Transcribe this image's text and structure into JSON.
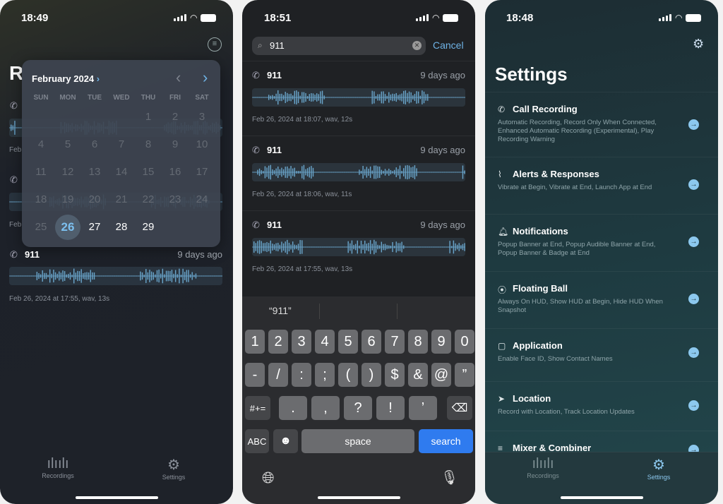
{
  "left": {
    "time": "18:49",
    "title_fragment": "R",
    "hidden_date_fragment": "Feb",
    "calendar": {
      "month": "February 2024",
      "weekdays": [
        "SUN",
        "MON",
        "TUE",
        "WED",
        "THU",
        "FRI",
        "SAT"
      ],
      "days": [
        "1",
        "2",
        "3",
        "4",
        "5",
        "6",
        "7",
        "8",
        "9",
        "10",
        "11",
        "12",
        "13",
        "14",
        "15",
        "16",
        "17",
        "18",
        "19",
        "20",
        "21",
        "22",
        "23",
        "24",
        "25",
        "26",
        "27",
        "28",
        "29"
      ],
      "selected": "26",
      "first_weekday_index": 4
    },
    "recording": {
      "number": "911",
      "ago": "9 days ago",
      "meta": "Feb 26, 2024 at 17:55, wav, 13s"
    },
    "tabs": [
      {
        "label": "Recordings",
        "icon": "waveform-icon"
      },
      {
        "label": "Settings",
        "icon": "gear-icon"
      }
    ]
  },
  "middle": {
    "time": "18:51",
    "search_value": "911",
    "cancel": "Cancel",
    "results": [
      {
        "number": "911",
        "ago": "9 days ago",
        "meta": "Feb 26, 2024 at 18:07, wav, 12s"
      },
      {
        "number": "911",
        "ago": "9 days ago",
        "meta": "Feb 26, 2024 at 18:06, wav, 11s"
      },
      {
        "number": "911",
        "ago": "9 days ago",
        "meta": "Feb 26, 2024 at 17:55, wav, 13s"
      }
    ],
    "keyboard": {
      "suggestion": "“911”",
      "row1": [
        "1",
        "2",
        "3",
        "4",
        "5",
        "6",
        "7",
        "8",
        "9",
        "0"
      ],
      "row2": [
        "-",
        "/",
        ":",
        ";",
        "(",
        ")",
        "$",
        "&",
        "@",
        "”"
      ],
      "row3": [
        ".",
        ",",
        "?",
        "!",
        "’"
      ],
      "symbols": "#+=",
      "abc": "ABC",
      "space": "space",
      "search": "search"
    }
  },
  "right": {
    "time": "18:48",
    "title": "Settings",
    "accent": "#8cc8ee",
    "items": [
      {
        "title": "Call Recording",
        "icon": "phone-icon",
        "desc": "Automatic Recording, Record Only When Connected, Enhanced Automatic Recording (Experimental), Play Recording Warning"
      },
      {
        "title": "Alerts & Responses",
        "icon": "waveform-pulse-icon",
        "desc": "Vibrate at Begin, Vibrate at End, Launch App at End"
      },
      {
        "title": "Notifications",
        "icon": "bell-icon",
        "desc": "Popup Banner at End, Popup Audible Banner at End, Popup Banner & Badge at End"
      },
      {
        "title": "Floating Ball",
        "icon": "circle-dot-icon",
        "desc": "Always On HUD, Show HUD at Begin, Hide HUD When Snapshot"
      },
      {
        "title": "Application",
        "icon": "app-check-icon",
        "desc": "Enable Face ID, Show Contact Names"
      },
      {
        "title": "Location",
        "icon": "location-arrow-icon",
        "desc": "Record with Location, Track Location Updates"
      },
      {
        "title": "Mixer & Combiner",
        "icon": "sliders-icon",
        "desc": ""
      }
    ],
    "tabs": [
      {
        "label": "Recordings",
        "icon": "waveform-icon"
      },
      {
        "label": "Settings",
        "icon": "gear-icon",
        "active": true
      }
    ]
  }
}
